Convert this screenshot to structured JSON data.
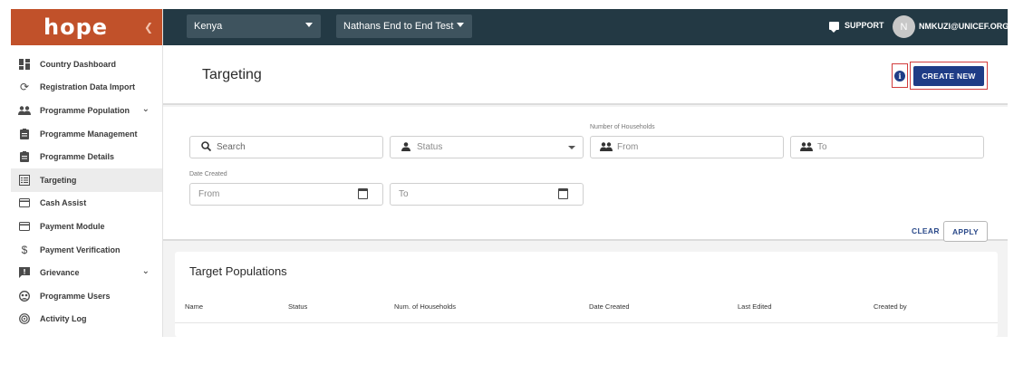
{
  "app": {
    "logo_text": "hope",
    "collapse_icon": "chevron-left-icon"
  },
  "sidebar": {
    "items": [
      {
        "label": "Country Dashboard",
        "icon": "dashboard-icon"
      },
      {
        "label": "Registration Data Import",
        "icon": "refresh-icon"
      },
      {
        "label": "Programme Population",
        "icon": "people-icon",
        "expandable": true
      },
      {
        "label": "Programme Management",
        "icon": "clipboard-icon"
      },
      {
        "label": "Programme Details",
        "icon": "clipboard-icon"
      },
      {
        "label": "Targeting",
        "icon": "list-icon",
        "active": true
      },
      {
        "label": "Cash Assist",
        "icon": "card-icon"
      },
      {
        "label": "Payment Module",
        "icon": "card-icon"
      },
      {
        "label": "Payment Verification",
        "icon": "dollar-icon"
      },
      {
        "label": "Grievance",
        "icon": "feedback-icon",
        "expandable": true
      },
      {
        "label": "Programme Users",
        "icon": "users-icon"
      },
      {
        "label": "Activity Log",
        "icon": "activity-icon"
      }
    ]
  },
  "topbar": {
    "country": "Kenya",
    "programme": "Nathans End to End Test",
    "support_label": "SUPPORT",
    "avatar_initial": "N",
    "user_email": "NMKUZI@UNICEF.ORG"
  },
  "header": {
    "title": "Targeting",
    "create_label": "CREATE NEW",
    "info_icon": "info-icon"
  },
  "filters": {
    "search_placeholder": "Search",
    "status_placeholder": "Status",
    "households_label": "Number of Households",
    "households_from": "From",
    "households_to": "To",
    "date_label": "Date Created",
    "date_from": "From",
    "date_to": "To",
    "clear_label": "CLEAR",
    "apply_label": "APPLY"
  },
  "table": {
    "title": "Target Populations",
    "columns": [
      "Name",
      "Status",
      "Num. of Households",
      "Date Created",
      "Last Edited",
      "Created by"
    ]
  },
  "colors": {
    "brand": "#c1512a",
    "topbar": "#233944",
    "primary": "#1f3c86",
    "highlight": "#d23c3c"
  }
}
